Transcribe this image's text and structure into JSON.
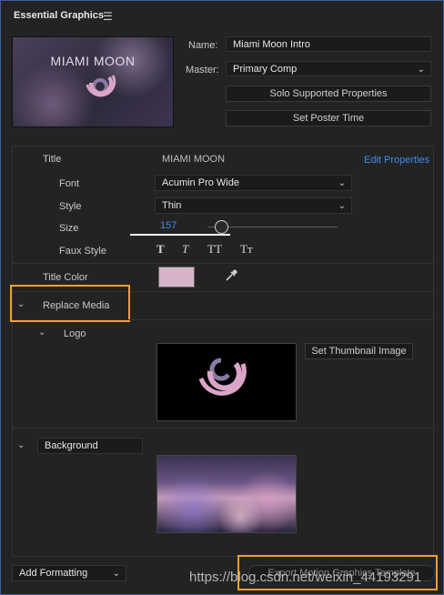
{
  "panel": {
    "title": "Essential Graphics",
    "menu_icon": "hamburger-icon"
  },
  "thumbnail": {
    "title_text": "MIAMI MOON"
  },
  "fields": {
    "name_label": "Name:",
    "name_value": "Miami Moon Intro",
    "master_label": "Master:",
    "master_value": "Primary Comp"
  },
  "buttons": {
    "solo": "Solo Supported Properties",
    "poster": "Set Poster Time",
    "thumbnail": "Set Thumbnail Image",
    "export": "Export Motion Graphics Template"
  },
  "title_group": {
    "label": "Title",
    "value": "MIAMI MOON",
    "edit_link": "Edit Properties",
    "font_label": "Font",
    "font_value": "Acumin Pro Wide",
    "style_label": "Style",
    "style_value": "Thin",
    "size_label": "Size",
    "size_value": "157",
    "faux_label": "Faux Style",
    "faux_buttons": [
      "T",
      "T",
      "TT",
      "Tт"
    ]
  },
  "title_color": {
    "label": "Title Color",
    "swatch": "#d6b3c8"
  },
  "replace_media": {
    "label": "Replace Media",
    "logo_label": "Logo"
  },
  "background": {
    "label": "Background"
  },
  "formatting": {
    "label": "Add Formatting"
  },
  "colors": {
    "link": "#3d8ef0",
    "highlight": "#f0a030",
    "logo_pink": "#dba5c8",
    "logo_purple": "#8c7aa6"
  },
  "watermark": "https://blog.csdn.net/weixin_44193291"
}
